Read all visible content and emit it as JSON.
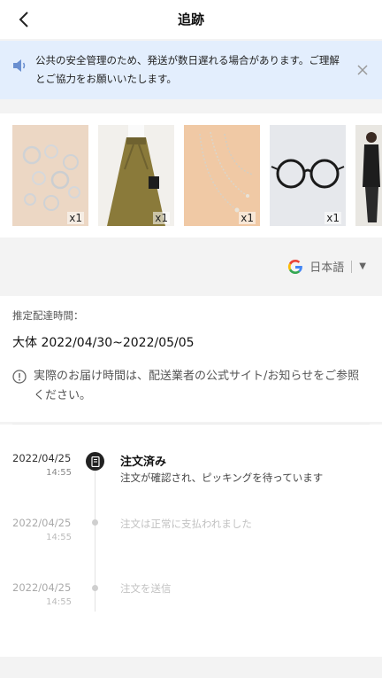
{
  "header": {
    "title": "追跡",
    "back_icon": "chevron-left-icon"
  },
  "notice": {
    "icon": "speaker-icon",
    "text": "公共の安全管理のため、発送が数日遅れる場合があります。ご理解とご協力をお願いいたします。",
    "close_icon": "close-icon",
    "background": "#e3eefd"
  },
  "products": [
    {
      "name": "rings",
      "qty": "x1"
    },
    {
      "name": "skirt",
      "qty": "x1"
    },
    {
      "name": "necklace",
      "qty": "x1"
    },
    {
      "name": "glasses",
      "qty": "x1"
    },
    {
      "name": "outfit",
      "qty": ""
    }
  ],
  "translate": {
    "icon": "google-icon",
    "language": "日本語",
    "caret": "▼"
  },
  "delivery": {
    "estimate_label": "推定配達時間：",
    "estimate_range": "大体 2022/04/30~2022/05/05",
    "info_icon": "info-circle-icon",
    "info_text": "実際のお届け時間は、配送業者の公式サイト/お知らせをご参照ください。"
  },
  "timeline": [
    {
      "date": "2022/04/25",
      "time": "14:55",
      "title": "注文済み",
      "desc": "注文が確認され、ピッキングを待っています",
      "active": true
    },
    {
      "date": "2022/04/25",
      "time": "14:55",
      "title": "注文は正常に支払われました",
      "active": false
    },
    {
      "date": "2022/04/25",
      "time": "14:55",
      "title": "注文を送信",
      "active": false
    }
  ]
}
